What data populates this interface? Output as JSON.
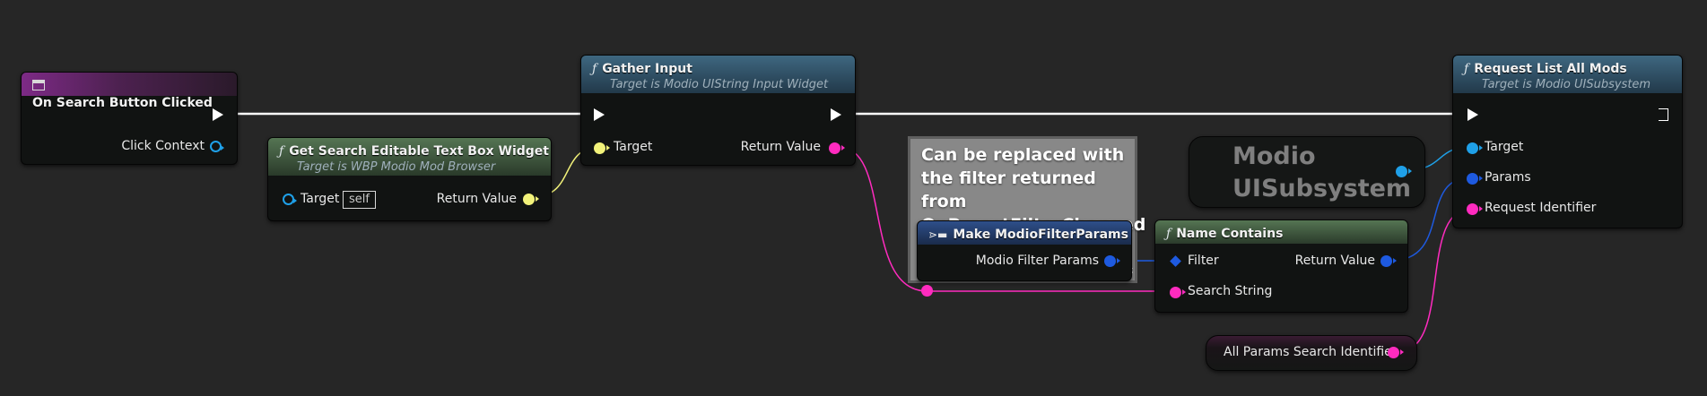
{
  "colors": {
    "background": "#262626",
    "exec_wire": "#ffffff",
    "string_wire": "#ff2bbf",
    "object_wire": "#f2f27a",
    "subsystem_wire": "#1fa0e8",
    "struct_wire": "#1e5ae0"
  },
  "nodes": {
    "on_search": {
      "title": "On Search Button Clicked",
      "icon": "event-icon",
      "click_context": "Click Context"
    },
    "get_search": {
      "title": "Get Search Editable Text Box Widget",
      "subtitle": "Target is WBP Modio Mod Browser",
      "icon": "function-icon",
      "target": "Target",
      "target_default": "self",
      "return_value": "Return Value"
    },
    "gather_input": {
      "title": "Gather Input",
      "subtitle": "Target is Modio UIString Input Widget",
      "icon": "function-icon",
      "target": "Target",
      "return_value": "Return Value"
    },
    "comment": {
      "text": "Can be replaced with the filter returned from OnPresetFilterChanged"
    },
    "make_filter": {
      "title": "Make ModioFilterParams",
      "icon": "make-struct-icon",
      "output": "Modio Filter Params"
    },
    "subsystem_var": {
      "label": "Modio UISubsystem"
    },
    "name_contains": {
      "title": "Name Contains",
      "icon": "function-icon",
      "filter": "Filter",
      "search_string": "Search String",
      "return_value": "Return Value"
    },
    "request_list": {
      "title": "Request List All Mods",
      "subtitle": "Target is Modio UISubsystem",
      "icon": "function-icon",
      "target": "Target",
      "params": "Params",
      "request_identifier": "Request Identifier"
    },
    "all_params": {
      "label": "All Params Search Identifier"
    }
  }
}
